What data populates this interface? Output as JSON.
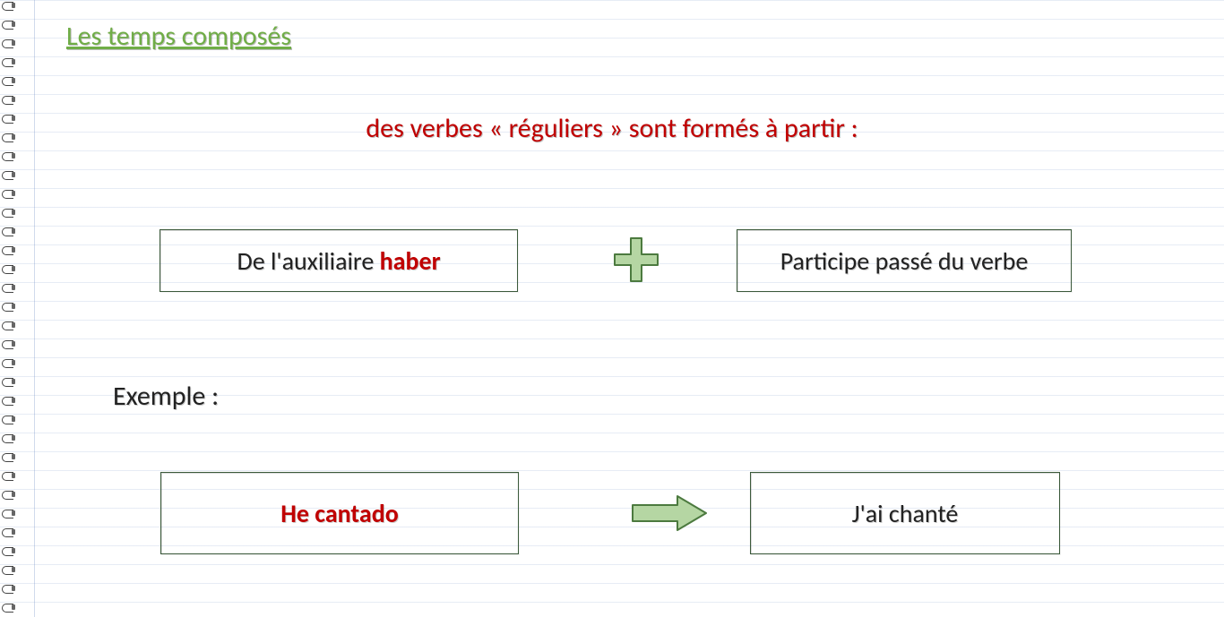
{
  "title": "Les temps composés",
  "subtitle": "des verbes « réguliers » sont formés à partir :",
  "formula": {
    "left_prefix": "De l'auxiliaire ",
    "left_strong": "haber",
    "right": "Participe passé du verbe"
  },
  "example_label": "Exemple :",
  "example": {
    "left": "He cantado",
    "right": "J'ai chanté"
  },
  "icons": {
    "plus": "plus-icon",
    "arrow": "arrow-right-icon"
  },
  "colors": {
    "title_green": "#70AD47",
    "accent_red": "#C00000",
    "box_border": "#3B5A3B",
    "shape_fill": "#B5D6A3",
    "shape_stroke": "#4C7A3F"
  }
}
